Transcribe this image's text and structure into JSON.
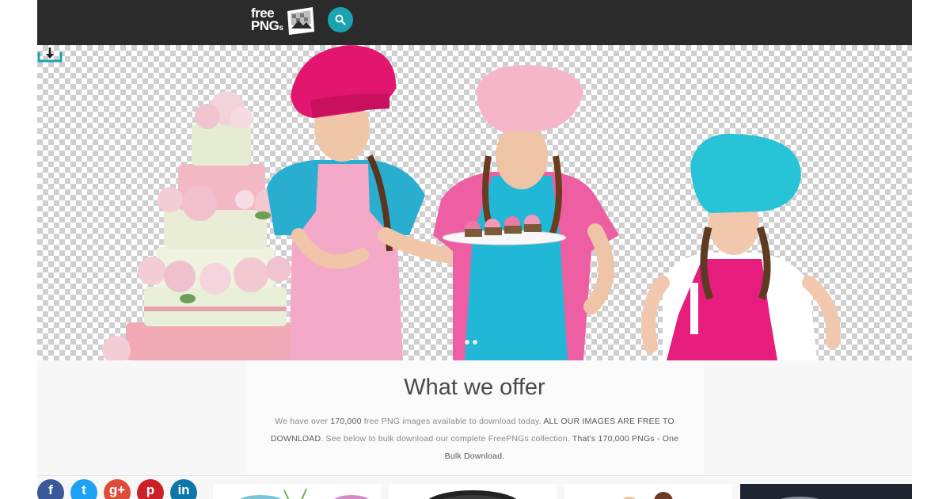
{
  "header": {
    "logo_line1": "free",
    "logo_line2": "PNG",
    "logo_suffix": "s",
    "search_icon": "search-icon"
  },
  "hero": {
    "slides": 2,
    "active_slide": 1,
    "download_icon": "download-icon"
  },
  "offer": {
    "title": "What we offer",
    "p1": "We have over ",
    "p1_count": "170,000",
    "p1_rest": " free PNG images available to download today. ",
    "p1_caps": "ALL OUR IMAGES ARE FREE TO DOWNLOAD",
    "p2": ". See below to bulk download our complete FreePNGs collection. ",
    "p2_bold": "That's 170,000 PNGs - ",
    "p3": "One Bulk Download."
  },
  "social": [
    {
      "name": "facebook",
      "glyph": "f",
      "color": "#3b5998"
    },
    {
      "name": "twitter",
      "glyph": "t",
      "color": "#1da1f2"
    },
    {
      "name": "google-plus",
      "glyph": "g+",
      "color": "#dd4b39"
    },
    {
      "name": "pinterest",
      "glyph": "p",
      "color": "#cb2027"
    },
    {
      "name": "linkedin",
      "glyph": "in",
      "color": "#0e76a8"
    }
  ],
  "colors": {
    "topbar": "#2b2b2b",
    "accent": "#1aa3b0",
    "pink_hat": "#e8197a",
    "teal_shirt": "#29b5d4"
  }
}
